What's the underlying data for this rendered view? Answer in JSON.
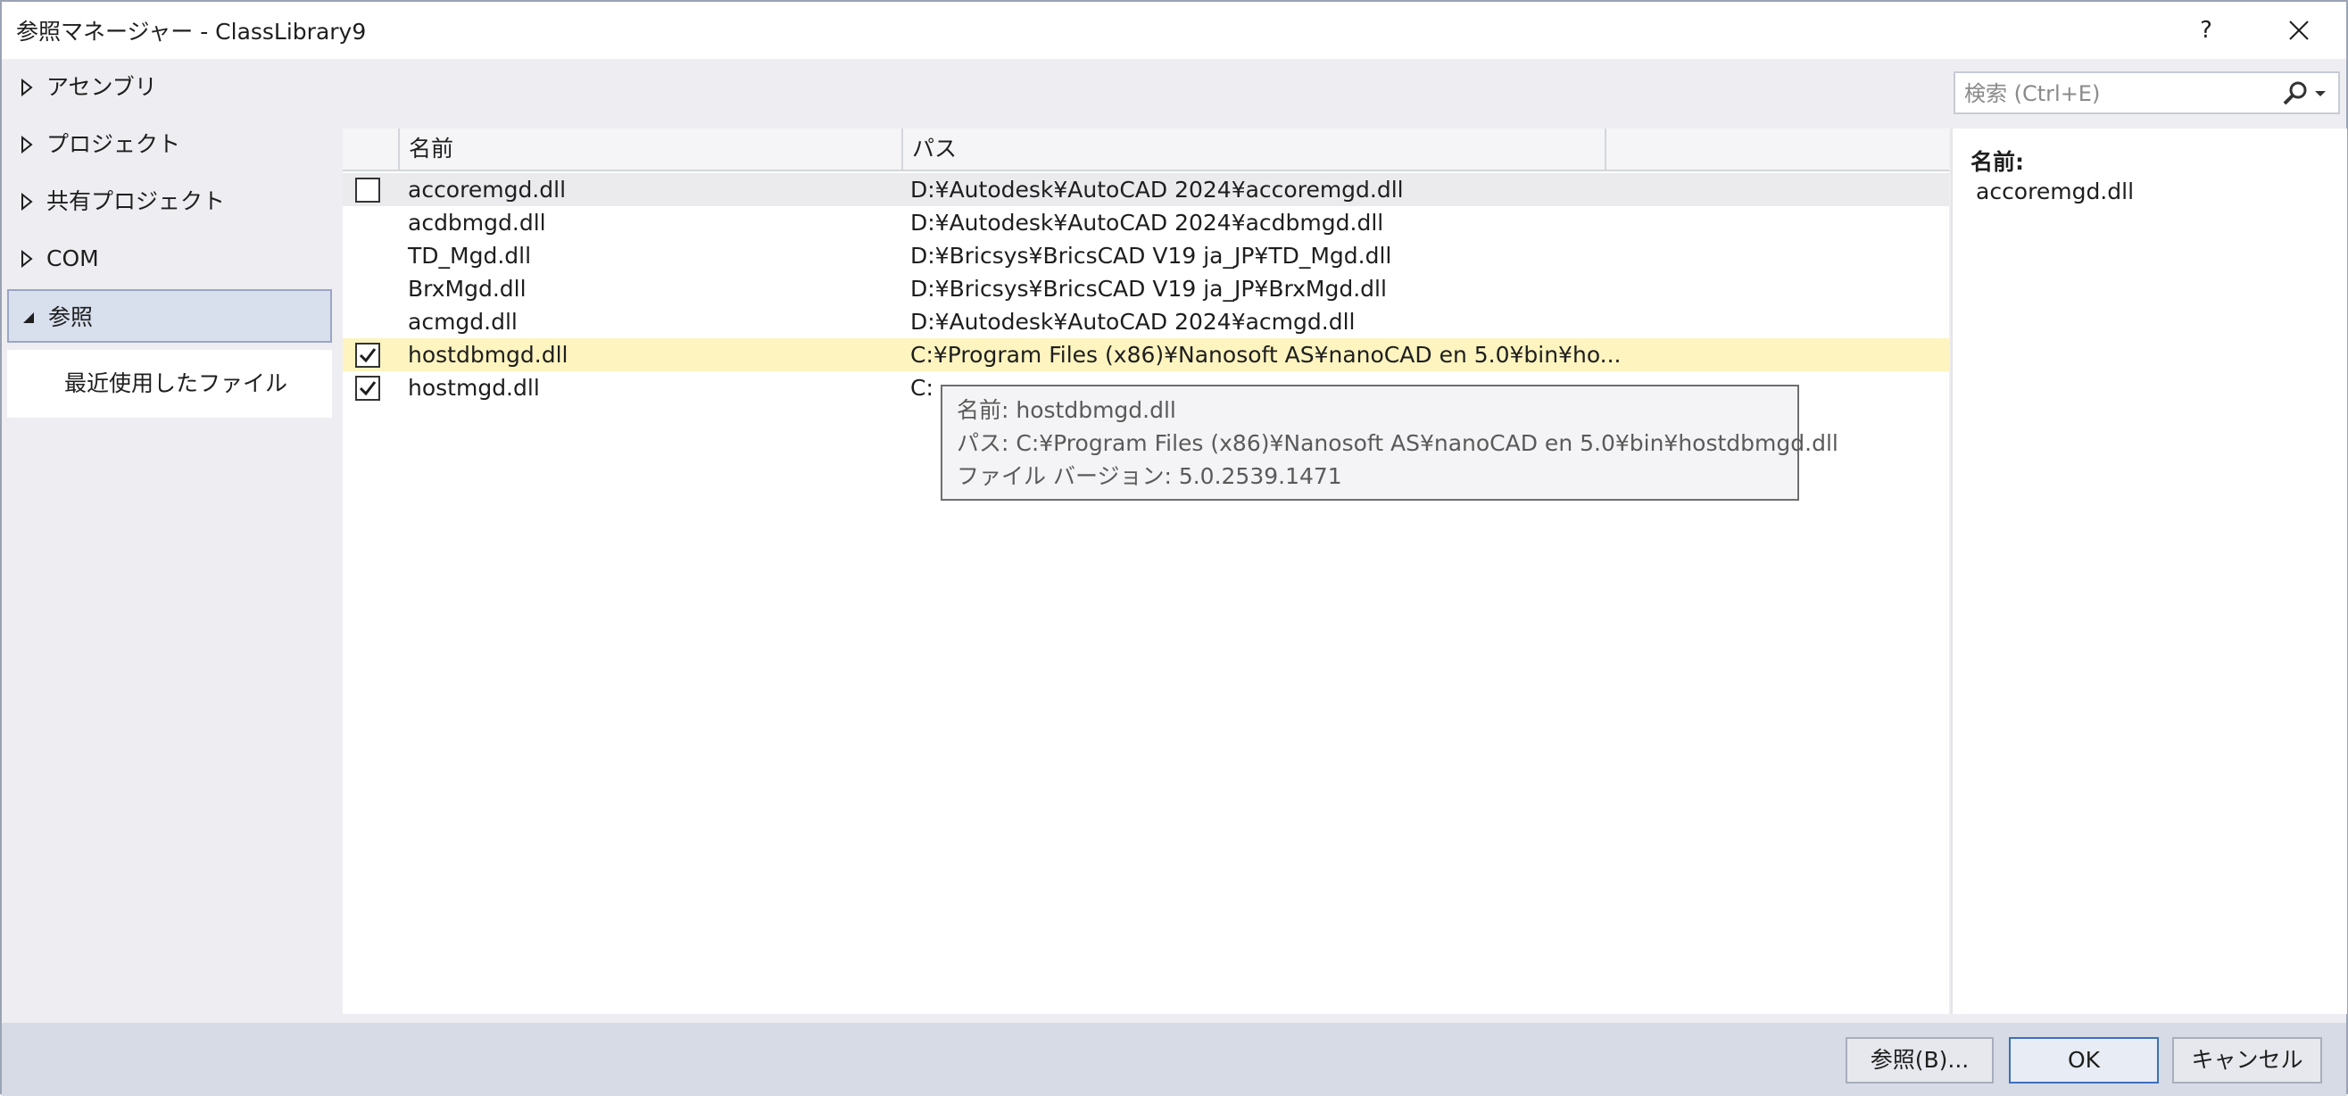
{
  "window": {
    "title": "参照マネージャー - ClassLibrary9",
    "help_label": "?"
  },
  "nav": {
    "items": [
      {
        "label": "アセンブリ",
        "expanded": false
      },
      {
        "label": "プロジェクト",
        "expanded": false
      },
      {
        "label": "共有プロジェクト",
        "expanded": false
      },
      {
        "label": "COM",
        "expanded": false
      },
      {
        "label": "参照",
        "expanded": true
      }
    ],
    "sub_item": "最近使用したファイル"
  },
  "search": {
    "placeholder": "検索 (Ctrl+E)"
  },
  "list": {
    "columns": [
      "名前",
      "パス"
    ],
    "rows": [
      {
        "name": "accoremgd.dll",
        "path": "D:¥Autodesk¥AutoCAD 2024¥accoremgd.dll",
        "checked": false,
        "show_checkbox": true
      },
      {
        "name": "acdbmgd.dll",
        "path": "D:¥Autodesk¥AutoCAD 2024¥acdbmgd.dll",
        "checked": false,
        "show_checkbox": false
      },
      {
        "name": "TD_Mgd.dll",
        "path": "D:¥Bricsys¥BricsCAD V19 ja_JP¥TD_Mgd.dll",
        "checked": false,
        "show_checkbox": false
      },
      {
        "name": "BrxMgd.dll",
        "path": "D:¥Bricsys¥BricsCAD V19 ja_JP¥BrxMgd.dll",
        "checked": false,
        "show_checkbox": false
      },
      {
        "name": "acmgd.dll",
        "path": "D:¥Autodesk¥AutoCAD 2024¥acmgd.dll",
        "checked": false,
        "show_checkbox": false
      },
      {
        "name": "hostdbmgd.dll",
        "path": "C:¥Program Files (x86)¥Nanosoft AS¥nanoCAD en 5.0¥bin¥ho...",
        "checked": true,
        "show_checkbox": true
      },
      {
        "name": "hostmgd.dll",
        "path": "C:",
        "checked": true,
        "show_checkbox": true
      }
    ]
  },
  "tooltip": {
    "name_line": "名前: hostdbmgd.dll",
    "path_line": "パス: C:¥Program Files (x86)¥Nanosoft AS¥nanoCAD en 5.0¥bin¥hostdbmgd.dll",
    "version_line": "ファイル バージョン: 5.0.2539.1471"
  },
  "details": {
    "label": "名前:",
    "value": "accoremgd.dll"
  },
  "footer": {
    "browse_label": "参照(B)...",
    "ok_label": "OK",
    "cancel_label": "キャンセル"
  }
}
